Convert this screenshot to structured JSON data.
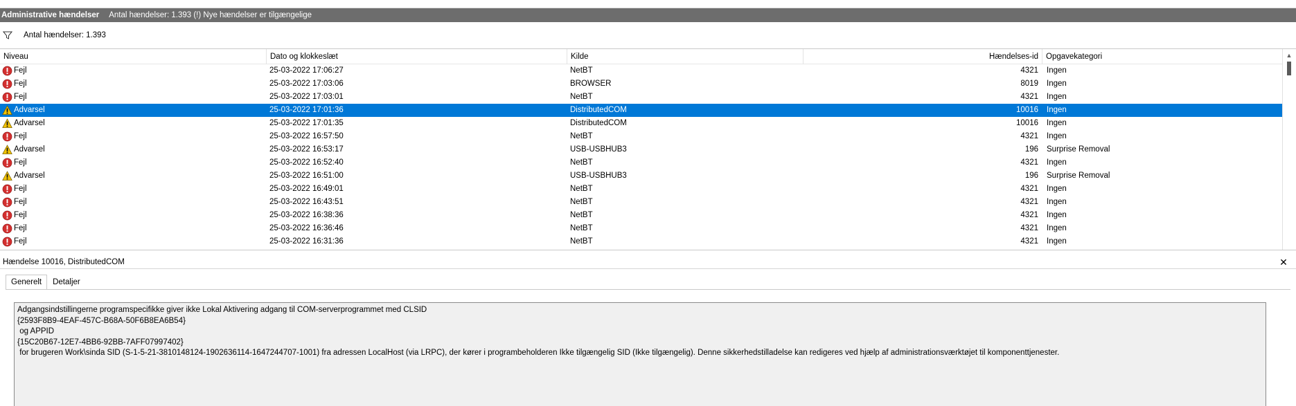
{
  "titlebar": {
    "title": "Administrative hændelser",
    "subtitle": "Antal hændelser: 1.393 (!) Nye hændelser er tilgængelige"
  },
  "filterbar": {
    "icon": "filter-icon",
    "count_text": "Antal hændelser: 1.393"
  },
  "table": {
    "columns": {
      "level": "Niveau",
      "date": "Dato og klokkeslæt",
      "source": "Kilde",
      "event_id": "Hændelses-id",
      "category": "Opgavekategori"
    },
    "rows": [
      {
        "icon": "error-icon",
        "level": "Fejl",
        "date": "25-03-2022 17:06:27",
        "source": "NetBT",
        "event_id": "4321",
        "category": "Ingen"
      },
      {
        "icon": "error-icon",
        "level": "Fejl",
        "date": "25-03-2022 17:03:06",
        "source": "BROWSER",
        "event_id": "8019",
        "category": "Ingen"
      },
      {
        "icon": "error-icon",
        "level": "Fejl",
        "date": "25-03-2022 17:03:01",
        "source": "NetBT",
        "event_id": "4321",
        "category": "Ingen"
      },
      {
        "icon": "warning-icon",
        "level": "Advarsel",
        "date": "25-03-2022 17:01:36",
        "source": "DistributedCOM",
        "event_id": "10016",
        "category": "Ingen",
        "selected": true
      },
      {
        "icon": "warning-icon",
        "level": "Advarsel",
        "date": "25-03-2022 17:01:35",
        "source": "DistributedCOM",
        "event_id": "10016",
        "category": "Ingen"
      },
      {
        "icon": "error-icon",
        "level": "Fejl",
        "date": "25-03-2022 16:57:50",
        "source": "NetBT",
        "event_id": "4321",
        "category": "Ingen"
      },
      {
        "icon": "warning-icon",
        "level": "Advarsel",
        "date": "25-03-2022 16:53:17",
        "source": "USB-USBHUB3",
        "event_id": "196",
        "category": "Surprise Removal"
      },
      {
        "icon": "error-icon",
        "level": "Fejl",
        "date": "25-03-2022 16:52:40",
        "source": "NetBT",
        "event_id": "4321",
        "category": "Ingen"
      },
      {
        "icon": "warning-icon",
        "level": "Advarsel",
        "date": "25-03-2022 16:51:00",
        "source": "USB-USBHUB3",
        "event_id": "196",
        "category": "Surprise Removal"
      },
      {
        "icon": "error-icon",
        "level": "Fejl",
        "date": "25-03-2022 16:49:01",
        "source": "NetBT",
        "event_id": "4321",
        "category": "Ingen"
      },
      {
        "icon": "error-icon",
        "level": "Fejl",
        "date": "25-03-2022 16:43:51",
        "source": "NetBT",
        "event_id": "4321",
        "category": "Ingen"
      },
      {
        "icon": "error-icon",
        "level": "Fejl",
        "date": "25-03-2022 16:38:36",
        "source": "NetBT",
        "event_id": "4321",
        "category": "Ingen"
      },
      {
        "icon": "error-icon",
        "level": "Fejl",
        "date": "25-03-2022 16:36:46",
        "source": "NetBT",
        "event_id": "4321",
        "category": "Ingen"
      },
      {
        "icon": "error-icon",
        "level": "Fejl",
        "date": "25-03-2022 16:31:36",
        "source": "NetBT",
        "event_id": "4321",
        "category": "Ingen"
      }
    ]
  },
  "detail": {
    "header": "Hændelse 10016, DistributedCOM",
    "close_label": "✕",
    "tabs": [
      "Generelt",
      "Detaljer"
    ],
    "message": "Adgangsindstillingerne programspecifikke giver ikke Lokal Aktivering adgang til COM-serverprogrammet med CLSID\n{2593F8B9-4EAF-457C-B68A-50F6B8EA6B54}\n og APPID\n{15C20B67-12E7-4BB6-92BB-7AFF07997402}\n for brugeren Work\\sinda SID (S-1-5-21-3810148124-1902636114-1647244707-1001) fra adressen LocalHost (via LRPC), der kører i programbeholderen Ikke tilgængelig SID (Ikke tilgængelig). Denne sikkerhedstilladelse kan redigeres ved hjælp af administrationsværktøjet til komponenttjenester."
  },
  "colors": {
    "titlebar_bg": "#6d6d6d",
    "selection": "#0078d7",
    "error": "#d32f2f",
    "warning": "#f2c200"
  }
}
